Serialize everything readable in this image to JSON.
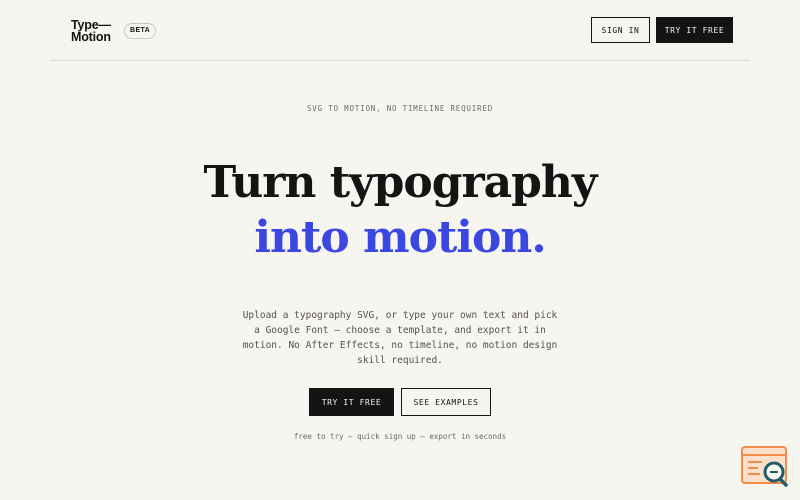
{
  "header": {
    "logo_line1": "Type—",
    "logo_line2": "Motion",
    "badge": "BETA",
    "signin_label": "SIGN IN",
    "try_label": "TRY IT FREE"
  },
  "hero": {
    "eyebrow": "SVG TO MOTION, NO TIMELINE REQUIRED",
    "headline_line1": "Turn typography",
    "headline_line2": "into motion.",
    "description": "Upload a typography SVG, or type your own text and pick a Google Font — choose a template, and export it in motion. No After Effects, no timeline, no motion design skill required.",
    "primary_cta": "TRY IT FREE",
    "secondary_cta": "SEE EXAMPLES",
    "footnote": "free to try — quick sign up — export in seconds"
  },
  "colors": {
    "background": "#f7f5f0",
    "ink": "#141414",
    "accent": "#3a47e0",
    "widget": "#f28c4b"
  },
  "widget": {
    "icon": "search-window-icon"
  }
}
